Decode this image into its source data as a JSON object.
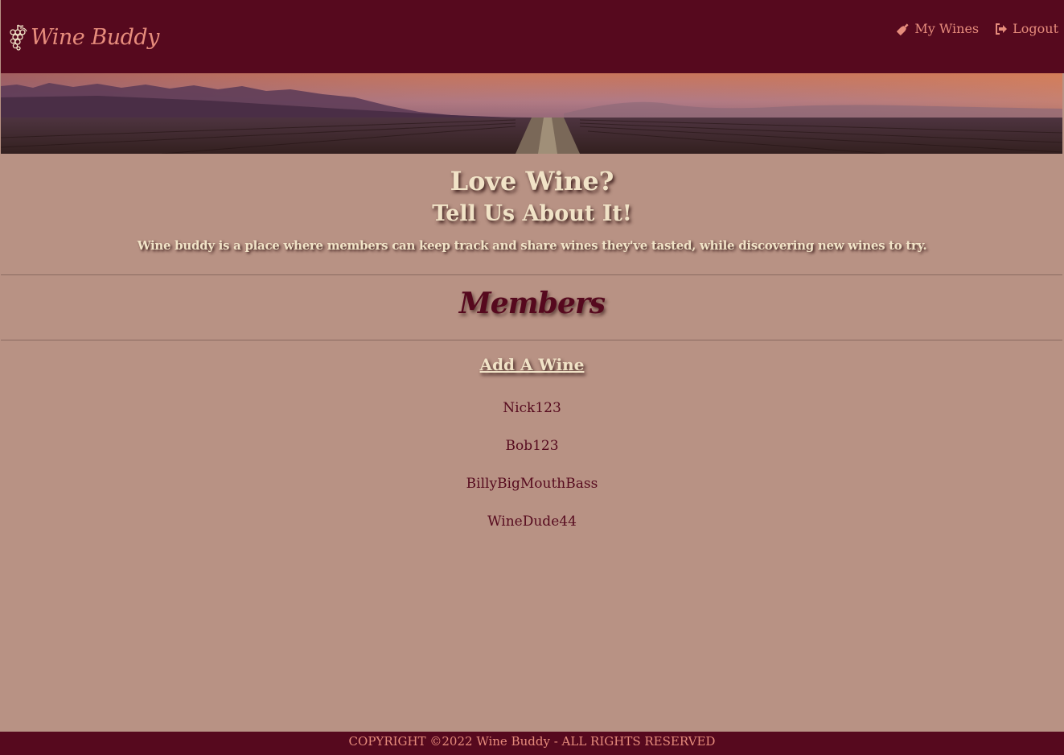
{
  "header": {
    "brand": "Wine Buddy",
    "brand_icon": "grapes-icon",
    "nav": [
      {
        "label": "My Wines",
        "icon": "wine-bottle-icon"
      },
      {
        "label": "Logout",
        "icon": "sign-out-icon"
      }
    ]
  },
  "hero": {
    "title": "Love Wine?",
    "subtitle": "Tell Us About It!",
    "description": "Wine buddy is a place where members can keep track and share wines they've tasted, while discovering new wines to try."
  },
  "members": {
    "title": "Members",
    "add_link": "Add A Wine",
    "list": [
      "Nick123",
      "Bob123",
      "BillyBigMouthBass",
      "WineDude44"
    ]
  },
  "footer": {
    "text": "COPYRIGHT ©2022 Wine Buddy - ALL RIGHTS RESERVED"
  },
  "colors": {
    "header_bg": "#56091e",
    "page_bg": "#b89284",
    "accent": "#e68c7c",
    "hero_text": "#f1e3c7"
  }
}
